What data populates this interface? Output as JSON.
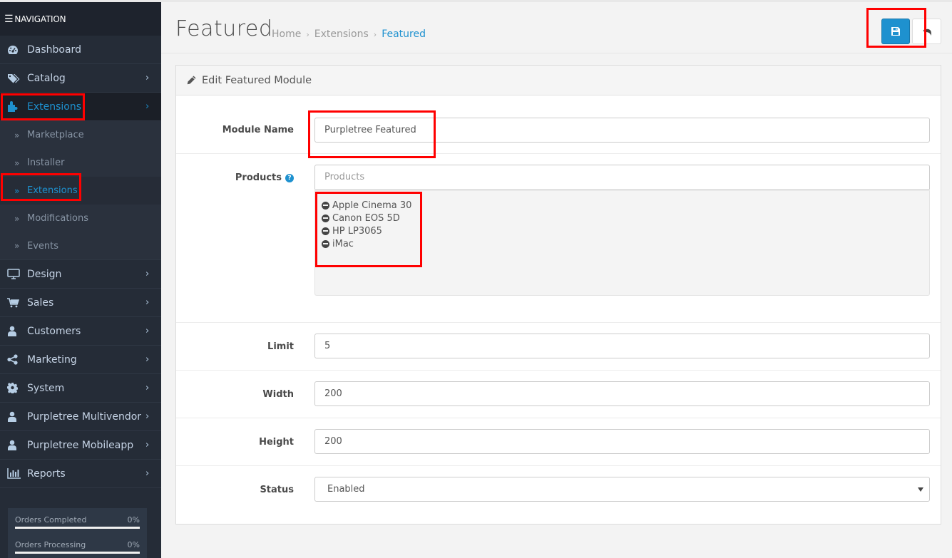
{
  "sidebar": {
    "header": "NAVIGATION",
    "menu": [
      {
        "label": "Dashboard",
        "icon": "dashboard-icon",
        "has_children": false
      },
      {
        "label": "Catalog",
        "icon": "tags-icon",
        "has_children": true
      },
      {
        "label": "Extensions",
        "icon": "puzzle-icon",
        "has_children": true,
        "active": true
      },
      {
        "label": "Design",
        "icon": "monitor-icon",
        "has_children": true
      },
      {
        "label": "Sales",
        "icon": "cart-icon",
        "has_children": true
      },
      {
        "label": "Customers",
        "icon": "user-icon",
        "has_children": true
      },
      {
        "label": "Marketing",
        "icon": "share-icon",
        "has_children": true
      },
      {
        "label": "System",
        "icon": "gear-icon",
        "has_children": true
      },
      {
        "label": "Purpletree Multivendor",
        "icon": "user-icon",
        "has_children": true
      },
      {
        "label": "Purpletree Mobileapp",
        "icon": "user-icon",
        "has_children": true
      },
      {
        "label": "Reports",
        "icon": "bar-chart-icon",
        "has_children": true
      }
    ],
    "extensions_submenu": [
      {
        "label": "Marketplace"
      },
      {
        "label": "Installer"
      },
      {
        "label": "Extensions",
        "active": true
      },
      {
        "label": "Modifications"
      },
      {
        "label": "Events"
      }
    ],
    "stats": [
      {
        "label": "Orders Completed",
        "value": "0%",
        "progress": 0
      },
      {
        "label": "Orders Processing",
        "value": "0%",
        "progress": 0
      }
    ]
  },
  "header": {
    "title": "Featured",
    "breadcrumb": [
      "Home",
      "Extensions",
      "Featured"
    ],
    "save_tooltip": "Save",
    "back_tooltip": "Cancel"
  },
  "panel": {
    "title": "Edit Featured Module",
    "fields": {
      "module_name": {
        "label": "Module Name",
        "value": "Purpletree Featured"
      },
      "products": {
        "label": "Products",
        "placeholder": "Products",
        "help": "?",
        "items": [
          "Apple Cinema 30",
          "Canon EOS 5D",
          "HP LP3065",
          "iMac"
        ]
      },
      "limit": {
        "label": "Limit",
        "value": "5"
      },
      "width": {
        "label": "Width",
        "value": "200"
      },
      "height": {
        "label": "Height",
        "value": "200"
      },
      "status": {
        "label": "Status",
        "value": "Enabled"
      }
    }
  },
  "colors": {
    "accent": "#1e91cf",
    "sidebar_bg": "#252c37",
    "highlight": "#ff0000"
  }
}
